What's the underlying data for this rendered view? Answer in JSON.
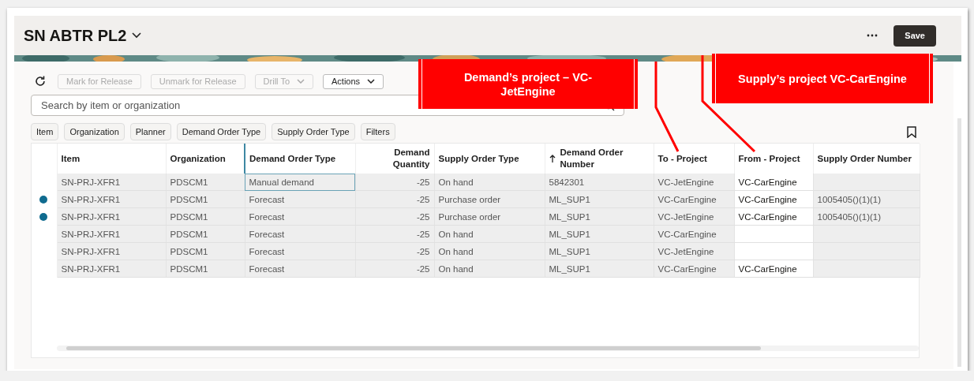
{
  "header": {
    "title": "SN ABTR PL2",
    "save_label": "Save"
  },
  "toolbar": {
    "buttons": [
      {
        "label": "Mark for Release",
        "disabled": true,
        "kind": "button"
      },
      {
        "label": "Unmark for Release",
        "disabled": true,
        "kind": "button"
      },
      {
        "label": "Drill To",
        "disabled": true,
        "kind": "menu"
      },
      {
        "label": "Actions",
        "disabled": false,
        "kind": "menu"
      }
    ]
  },
  "search": {
    "placeholder": "Search by item or organization"
  },
  "filter_chips": [
    "Item",
    "Organization",
    "Planner",
    "Demand Order Type",
    "Supply Order Type",
    "Filters"
  ],
  "table": {
    "columns": [
      {
        "label": "Item",
        "kind": "text",
        "editable": false,
        "focused": false,
        "sorted": false
      },
      {
        "label": "Organization",
        "kind": "text",
        "editable": false,
        "focused": false,
        "sorted": false
      },
      {
        "label": "Demand Order Type",
        "kind": "text",
        "editable": false,
        "focused": true,
        "sorted": false
      },
      {
        "label": "Demand Quantity",
        "kind": "number",
        "editable": false,
        "focused": false,
        "sorted": false
      },
      {
        "label": "Supply Order Type",
        "kind": "text",
        "editable": false,
        "focused": false,
        "sorted": false
      },
      {
        "label": "Demand Order Number",
        "kind": "text",
        "editable": false,
        "focused": false,
        "sorted": true
      },
      {
        "label": "To - Project",
        "kind": "text",
        "editable": false,
        "focused": false,
        "sorted": false
      },
      {
        "label": "From - Project",
        "kind": "text",
        "editable": true,
        "focused": false,
        "sorted": false
      },
      {
        "label": "Supply Order Number",
        "kind": "text",
        "editable": false,
        "focused": false,
        "sorted": false
      }
    ],
    "rows": [
      {
        "marked": false,
        "selected": true,
        "cells": [
          "SN-PRJ-XFR1",
          "PDSCM1",
          "Manual demand",
          "-25",
          "On hand",
          "5842301",
          "VC-JetEngine",
          "VC-CarEngine",
          ""
        ]
      },
      {
        "marked": true,
        "selected": false,
        "cells": [
          "SN-PRJ-XFR1",
          "PDSCM1",
          "Forecast",
          "-25",
          "Purchase order",
          "ML_SUP1",
          "VC-CarEngine",
          "VC-CarEngine",
          "1005405()(1)(1)"
        ]
      },
      {
        "marked": true,
        "selected": false,
        "cells": [
          "SN-PRJ-XFR1",
          "PDSCM1",
          "Forecast",
          "-25",
          "Purchase order",
          "ML_SUP1",
          "VC-JetEngine",
          "VC-CarEngine",
          "1005405()(1)(1)"
        ]
      },
      {
        "marked": false,
        "selected": false,
        "cells": [
          "SN-PRJ-XFR1",
          "PDSCM1",
          "Forecast",
          "-25",
          "On hand",
          "ML_SUP1",
          "VC-CarEngine",
          "",
          ""
        ]
      },
      {
        "marked": false,
        "selected": false,
        "cells": [
          "SN-PRJ-XFR1",
          "PDSCM1",
          "Forecast",
          "-25",
          "On hand",
          "ML_SUP1",
          "VC-JetEngine",
          "",
          ""
        ]
      },
      {
        "marked": false,
        "selected": false,
        "cells": [
          "SN-PRJ-XFR1",
          "PDSCM1",
          "Forecast",
          "-25",
          "On hand",
          "ML_SUP1",
          "VC-CarEngine",
          "VC-CarEngine",
          ""
        ]
      }
    ]
  },
  "callouts": [
    {
      "text": "Demand’s project – VC-JetEngine"
    },
    {
      "text": "Supply’s project VC-CarEngine"
    }
  ]
}
